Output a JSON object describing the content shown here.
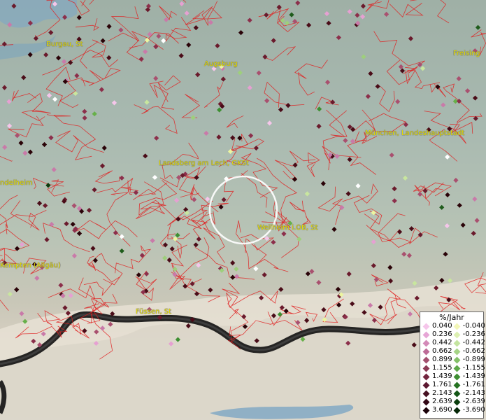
{
  "map": {
    "cities": [
      {
        "id": "burgau",
        "label": "Burgau, St"
      },
      {
        "id": "augsburg",
        "label": "Augsburg"
      },
      {
        "id": "freising",
        "label": "Freising"
      },
      {
        "id": "muenchen",
        "label": "München, Landeshauptstadt"
      },
      {
        "id": "landsberg",
        "label": "Landsberg am Lech, GKSt"
      },
      {
        "id": "mindelheim",
        "label": "ndelheim"
      },
      {
        "id": "weilheim",
        "label": "Weilheim i.OB, St"
      },
      {
        "id": "kempten",
        "label": "Kempten (Allgäu)"
      },
      {
        "id": "fuessen",
        "label": "Füssen, St"
      }
    ],
    "station_marker_colors": [
      "#f5c6ea",
      "#e6a0d2",
      "#c97aa9",
      "#a9506f",
      "#8c2f4b",
      "#6a1a2c",
      "#4a0c18",
      "#2a0308",
      "#ecf5a0",
      "#c8e69e",
      "#9ecf7c",
      "#67b04a",
      "#3e8f32",
      "#1f5c1c",
      "#0d3a0c",
      "#ffffff"
    ],
    "highlight_circle_color": "#ffffff",
    "border_color": "#e02020"
  },
  "legend": {
    "title": "%/Jahr",
    "positive": [
      {
        "value": "0.040",
        "color": "#f5c6ea"
      },
      {
        "value": "0.236",
        "color": "#e6a6d6"
      },
      {
        "value": "0.442",
        "color": "#d38ab8"
      },
      {
        "value": "0.662",
        "color": "#bd6b97"
      },
      {
        "value": "0.899",
        "color": "#a3506f"
      },
      {
        "value": "1.155",
        "color": "#8c3a55"
      },
      {
        "value": "1.439",
        "color": "#73253f"
      },
      {
        "value": "1.761",
        "color": "#5b1830"
      },
      {
        "value": "2.143",
        "color": "#461022"
      },
      {
        "value": "2.639",
        "color": "#320716"
      },
      {
        "value": "3.690",
        "color": "#1c020a"
      }
    ],
    "negative": [
      {
        "value": "-0.040",
        "color": "#f3f7b8"
      },
      {
        "value": "-0.236",
        "color": "#dcefb2"
      },
      {
        "value": "-0.442",
        "color": "#c4e4a0"
      },
      {
        "value": "-0.662",
        "color": "#a6d486"
      },
      {
        "value": "-0.899",
        "color": "#84c068"
      },
      {
        "value": "-1.155",
        "color": "#5ea84a"
      },
      {
        "value": "-1.439",
        "color": "#3e8f32"
      },
      {
        "value": "-1.761",
        "color": "#257222"
      },
      {
        "value": "-2.143",
        "color": "#145616"
      },
      {
        "value": "-2.639",
        "color": "#0b3e0d"
      },
      {
        "value": "-3.690",
        "color": "#062808"
      }
    ]
  }
}
